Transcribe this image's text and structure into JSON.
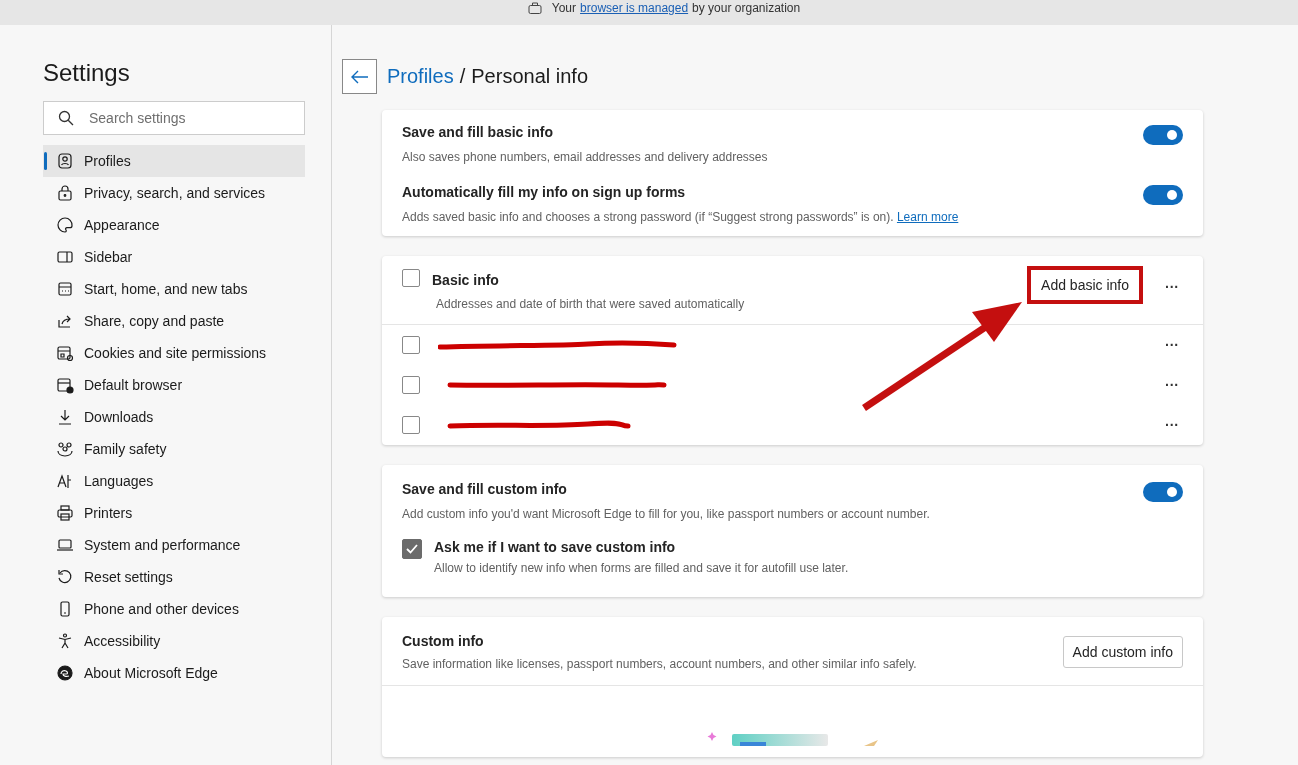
{
  "banner": {
    "before": "Your",
    "link": "browser is managed",
    "after": "by your organization"
  },
  "sidebar": {
    "title": "Settings",
    "search": {
      "placeholder": "Search settings"
    },
    "items": [
      {
        "label": "Profiles",
        "selected": true
      },
      {
        "label": "Privacy, search, and services",
        "selected": false
      },
      {
        "label": "Appearance",
        "selected": false
      },
      {
        "label": "Sidebar",
        "selected": false
      },
      {
        "label": "Start, home, and new tabs",
        "selected": false
      },
      {
        "label": "Share, copy and paste",
        "selected": false
      },
      {
        "label": "Cookies and site permissions",
        "selected": false
      },
      {
        "label": "Default browser",
        "selected": false
      },
      {
        "label": "Downloads",
        "selected": false
      },
      {
        "label": "Family safety",
        "selected": false
      },
      {
        "label": "Languages",
        "selected": false
      },
      {
        "label": "Printers",
        "selected": false
      },
      {
        "label": "System and performance",
        "selected": false
      },
      {
        "label": "Reset settings",
        "selected": false
      },
      {
        "label": "Phone and other devices",
        "selected": false
      },
      {
        "label": "Accessibility",
        "selected": false
      },
      {
        "label": "About Microsoft Edge",
        "selected": false
      }
    ]
  },
  "breadcrumb": {
    "parent": "Profiles",
    "separator": "/",
    "current": "Personal info"
  },
  "basic_settings": [
    {
      "title": "Save and fill basic info",
      "description": "Also saves phone numbers, email addresses and delivery addresses",
      "on": true
    },
    {
      "title": "Automatically fill my info on sign up forms",
      "description": "Adds saved basic info and chooses a strong password (if “Suggest strong passwords” is on).",
      "link": "Learn more",
      "on": true
    }
  ],
  "basic_info": {
    "title": "Basic info",
    "subtitle": "Addresses and date of birth that were saved automatically",
    "checked": false,
    "add_button": "Add basic info",
    "more": "···",
    "entries": [
      {
        "checked": false,
        "more": "···"
      },
      {
        "checked": false,
        "more": "···"
      },
      {
        "checked": false,
        "more": "···"
      }
    ]
  },
  "custom_settings": {
    "title": "Save and fill custom info",
    "description": "Add custom info you'd want Microsoft Edge to fill for you, like passport numbers or account number.",
    "on": true,
    "ask": {
      "title": "Ask me if I want to save custom info",
      "description": "Allow to identify new info when forms are filled and save it for autofill use later.",
      "checked": true
    }
  },
  "custom_info": {
    "title": "Custom info",
    "description": "Save information like licenses, passport numbers, account numbers, and other similar info safely.",
    "add_button": "Add custom info"
  }
}
